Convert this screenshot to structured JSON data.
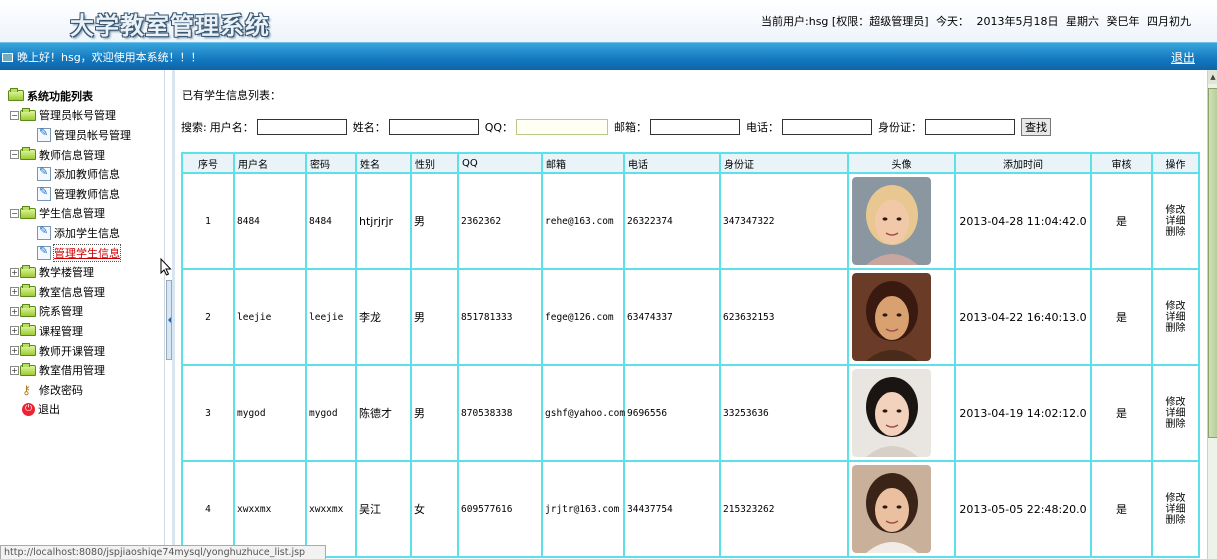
{
  "app": {
    "title": "大学教室管理系统"
  },
  "header": {
    "current_user": "当前用户:hsg [权限：超级管理员]",
    "today_label": "今天：",
    "date": "2013年5月18日",
    "weekday": "星期六",
    "lunar_year": "癸巳年",
    "lunar_day": "四月初九"
  },
  "bar": {
    "greeting": "晚上好！hsg，欢迎使用本系统！！！",
    "logout": "退出"
  },
  "sidebar": {
    "root": "系统功能列表",
    "items": [
      {
        "label": "管理员帐号管理",
        "type": "folder",
        "expanded": true
      },
      {
        "label": "管理员帐号管理",
        "type": "leaf"
      },
      {
        "label": "教师信息管理",
        "type": "folder",
        "expanded": true
      },
      {
        "label": "添加教师信息",
        "type": "leaf"
      },
      {
        "label": "管理教师信息",
        "type": "leaf"
      },
      {
        "label": "学生信息管理",
        "type": "folder",
        "expanded": true
      },
      {
        "label": "添加学生信息",
        "type": "leaf"
      },
      {
        "label": "管理学生信息",
        "type": "leaf",
        "selected": true
      },
      {
        "label": "教学楼管理",
        "type": "folder",
        "expanded": false
      },
      {
        "label": "教室信息管理",
        "type": "folder",
        "expanded": false
      },
      {
        "label": "院系管理",
        "type": "folder",
        "expanded": false
      },
      {
        "label": "课程管理",
        "type": "folder",
        "expanded": false
      },
      {
        "label": "教师开课管理",
        "type": "folder",
        "expanded": false
      },
      {
        "label": "教室借用管理",
        "type": "folder",
        "expanded": false
      },
      {
        "label": "修改密码",
        "type": "key"
      },
      {
        "label": "退出",
        "type": "exit"
      }
    ]
  },
  "main": {
    "list_title": "已有学生信息列表：",
    "search": {
      "label": "搜索:",
      "username_label": "用户名：",
      "name_label": "姓名：",
      "qq_label": "QQ：",
      "email_label": "邮箱：",
      "phone_label": "电话：",
      "idcard_label": "身份证：",
      "button": "查找"
    },
    "columns": [
      "序号",
      "用户名",
      "密码",
      "姓名",
      "性别",
      "QQ",
      "邮箱",
      "电话",
      "身份证",
      "头像",
      "添加时间",
      "审核",
      "操作"
    ],
    "ops": {
      "edit": "修改",
      "detail": "详细",
      "delete": "删除"
    },
    "rows": [
      {
        "no": "1",
        "username": "8484",
        "password": "8484",
        "name": "htjrjrjr",
        "gender": "男",
        "qq": "2362362",
        "email": "rehe@163.com",
        "phone": "26322374",
        "idcard": "347347322",
        "added": "2013-04-28 11:04:42.0",
        "audit": "是",
        "photo": "blonde-woman"
      },
      {
        "no": "2",
        "username": "leejie",
        "password": "leejie",
        "name": "李龙",
        "gender": "男",
        "qq": "851781333",
        "email": "fege@126.com",
        "phone": "63474337",
        "idcard": "623632153",
        "added": "2013-04-22 16:40:13.0",
        "audit": "是",
        "photo": "young-man"
      },
      {
        "no": "3",
        "username": "mygod",
        "password": "mygod",
        "name": "陈德才",
        "gender": "男",
        "qq": "870538338",
        "email": "gshf@yahoo.com",
        "phone": "9696556",
        "idcard": "33253636",
        "added": "2013-04-19 14:02:12.0",
        "audit": "是",
        "photo": "smiling-woman"
      },
      {
        "no": "4",
        "username": "xwxxmx",
        "password": "xwxxmx",
        "name": "吴江",
        "gender": "女",
        "qq": "609577616",
        "email": "jrjtr@163.com",
        "phone": "34437754",
        "idcard": "215323262",
        "added": "2013-05-05 22:48:20.0",
        "audit": "是",
        "photo": "peace-sign-person"
      }
    ]
  },
  "status": {
    "url": "http://localhost:8080/jspjiaoshiqe74mysql/yonghuzhuce_list.jsp"
  },
  "colors": {
    "accent": "#1478c0",
    "grid_border": "#5ee0e8",
    "selected": "#cc0000"
  }
}
